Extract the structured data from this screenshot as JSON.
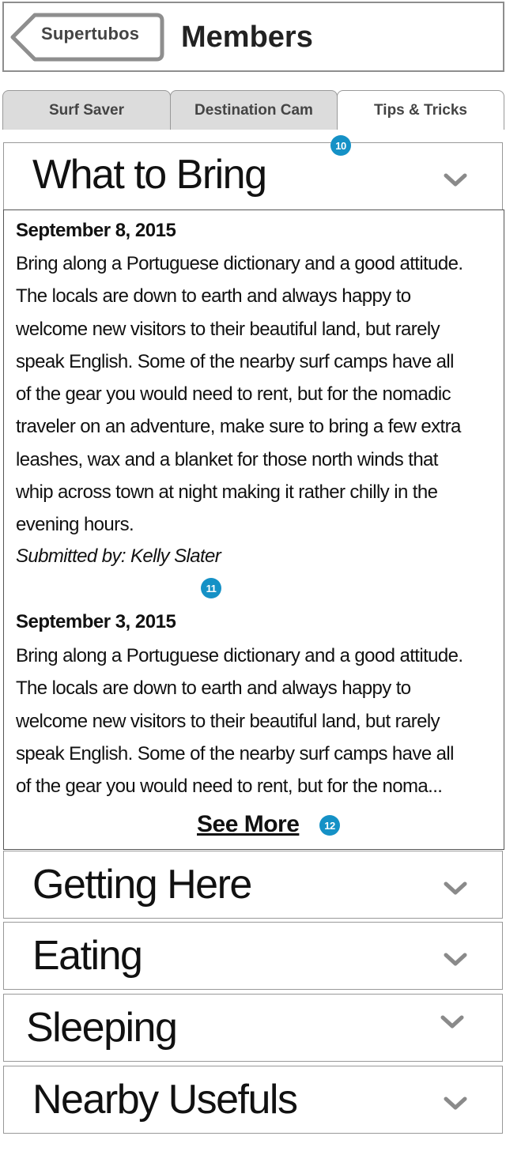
{
  "header": {
    "back_label": "Supertubos",
    "title": "Members"
  },
  "tabs": [
    {
      "label": "Surf Saver",
      "active": false
    },
    {
      "label": "Destination Cam",
      "active": false
    },
    {
      "label": "Tips & Tricks",
      "active": true
    }
  ],
  "badges": [
    "10",
    "11",
    "12"
  ],
  "sections": {
    "what_to_bring": "What to Bring",
    "getting_here": "Getting Here",
    "eating": "Eating",
    "sleeping": "Sleeping",
    "nearby_usefuls": "Nearby Usefuls"
  },
  "posts": [
    {
      "date": "September 8, 2015",
      "lines": [
        "Bring along a Portuguese dictionary and a good attitude.",
        "The locals are down to earth and always happy to",
        "welcome new visitors to their beautiful land, but rarely",
        "speak English. Some of the nearby surf camps have all",
        "of the gear you would need to rent, but for the nomadic",
        "traveler on an adventure, make sure to bring a few extra",
        "leashes, wax and a blanket for those north winds that",
        "whip across town at night making it rather chilly in the",
        "evening hours."
      ],
      "author": "Submitted by: Kelly Slater"
    },
    {
      "date": "September 3, 2015",
      "lines": [
        "Bring along a Portuguese dictionary and a good attitude.",
        "The locals are down to earth and always happy to",
        "welcome new visitors to their beautiful land, but rarely",
        "speak English. Some of the nearby surf camps have all",
        "of the gear you would need to rent, but for the noma..."
      ]
    }
  ],
  "see_more_label": "See More",
  "colors": {
    "badge": "#1591c6",
    "tab_inactive": "#dcdcdc",
    "border": "#999999"
  },
  "icons": [
    "chevron-down-icon",
    "back-arrow-icon"
  ]
}
